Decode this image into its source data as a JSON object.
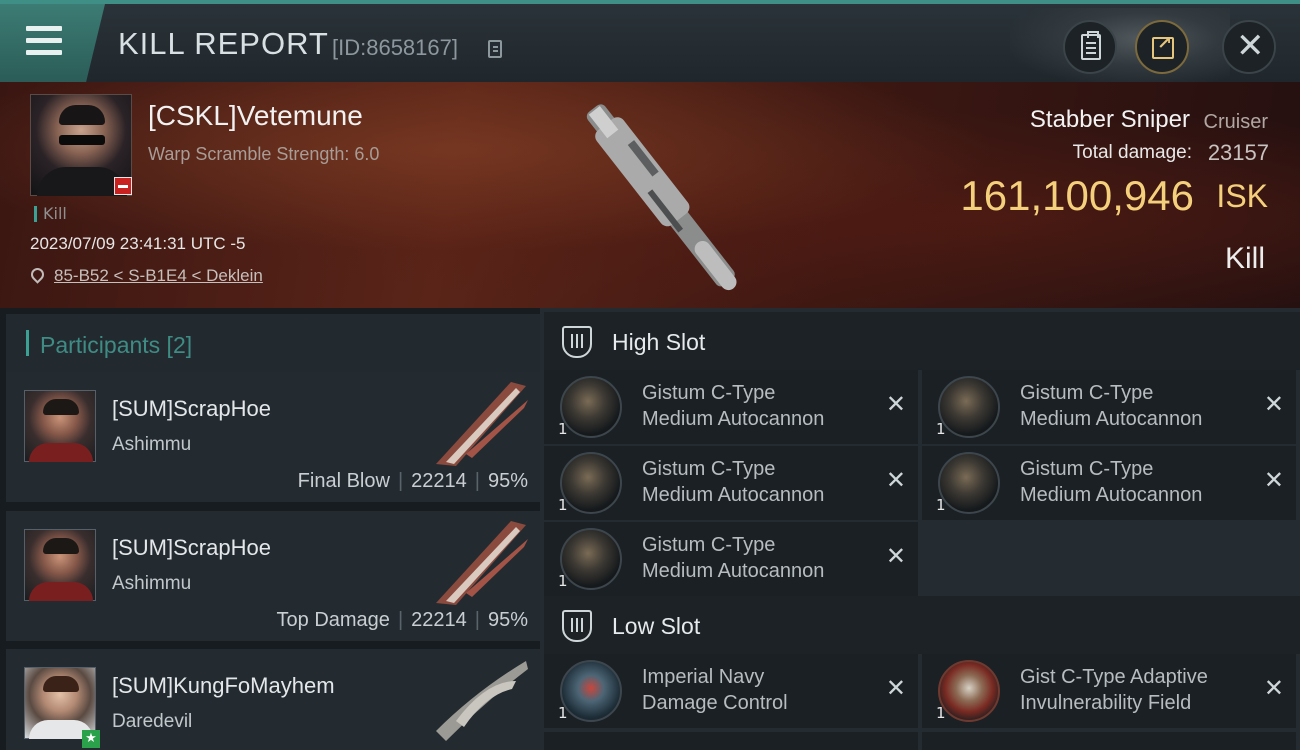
{
  "header": {
    "title": "KILL REPORT",
    "report_id": "[ID:8658167]"
  },
  "victim": {
    "name": "[CSKL]Vetemune",
    "scramble": "Warp Scramble Strength: 6.0",
    "tag": "Kill",
    "datetime": "2023/07/09 23:41:31 UTC -5",
    "location": "85-B52 < S-B1E4 < Deklein",
    "ship_name": "Stabber Sniper",
    "ship_class": "Cruiser",
    "total_damage_label": "Total damage:",
    "total_damage": "23157",
    "isk_value": "161,100,946",
    "isk_unit": "ISK",
    "result": "Kill"
  },
  "participants": {
    "label": "Participants [2]",
    "rows": [
      {
        "name": "[SUM]ScrapHoe",
        "ship": "Ashimmu",
        "role": "Final Blow",
        "damage": "22214",
        "percent": "95%"
      },
      {
        "name": "[SUM]ScrapHoe",
        "ship": "Ashimmu",
        "role": "Top Damage",
        "damage": "22214",
        "percent": "95%"
      },
      {
        "name": "[SUM]KungFoMayhem",
        "ship": "Daredevil"
      }
    ]
  },
  "fitting": {
    "high_slot_label": "High Slot",
    "low_slot_label": "Low Slot",
    "high": [
      {
        "line1": "Gistum C-Type",
        "line2": "Medium Autocannon",
        "qty": "1"
      },
      {
        "line1": "Gistum C-Type",
        "line2": "Medium Autocannon",
        "qty": "1"
      },
      {
        "line1": "Gistum C-Type",
        "line2": "Medium Autocannon",
        "qty": "1"
      },
      {
        "line1": "Gistum C-Type",
        "line2": "Medium Autocannon",
        "qty": "1"
      },
      {
        "line1": "Gistum C-Type",
        "line2": "Medium Autocannon",
        "qty": "1"
      }
    ],
    "low": [
      {
        "line1": "Imperial Navy",
        "line2": "Damage Control",
        "qty": "1"
      },
      {
        "line1": "Gist C-Type Adaptive",
        "line2": "Invulnerability Field",
        "qty": "1"
      }
    ]
  },
  "icons": {
    "menu": "hamburger-menu-icon",
    "copy": "copy-icon",
    "clipboard": "clipboard-icon",
    "share": "share-icon",
    "close": "close-icon",
    "pin": "location-pin-icon",
    "remove": "x-icon"
  },
  "colors": {
    "accent": "#3aa194",
    "isk": "#f4cf7c",
    "banner": "#5a2418"
  }
}
